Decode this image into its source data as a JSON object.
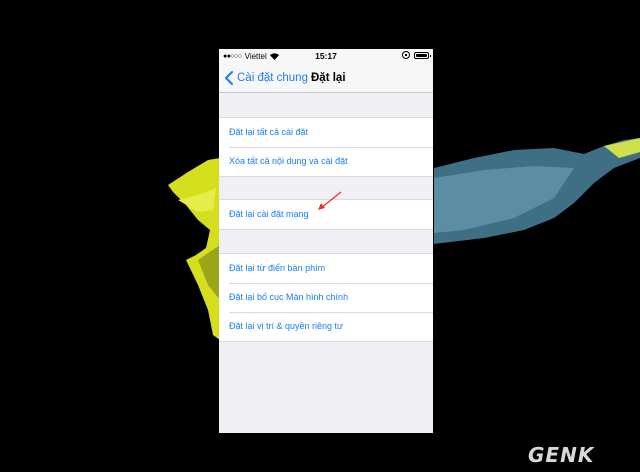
{
  "status_bar": {
    "carrier": "Viettel",
    "time": "15:17"
  },
  "nav": {
    "back_label": "Cài đặt chung",
    "title": "Đặt lại"
  },
  "groups": [
    {
      "rows": [
        "Đặt lại tất cả cài đặt",
        "Xóa tất cả nội dung và cài đặt"
      ]
    },
    {
      "rows": [
        "Đặt lại cài đặt mạng"
      ]
    },
    {
      "rows": [
        "Đặt lại từ điển bàn phím",
        "Đặt lại bố cục Màn hình chính",
        "Đặt lại vị trí & quyền riêng tư"
      ]
    }
  ],
  "annotation": {
    "arrow_color": "#e8322d"
  },
  "colors": {
    "accent": "#1a7ef7",
    "background": "#efeff4"
  },
  "watermark": "GENK"
}
